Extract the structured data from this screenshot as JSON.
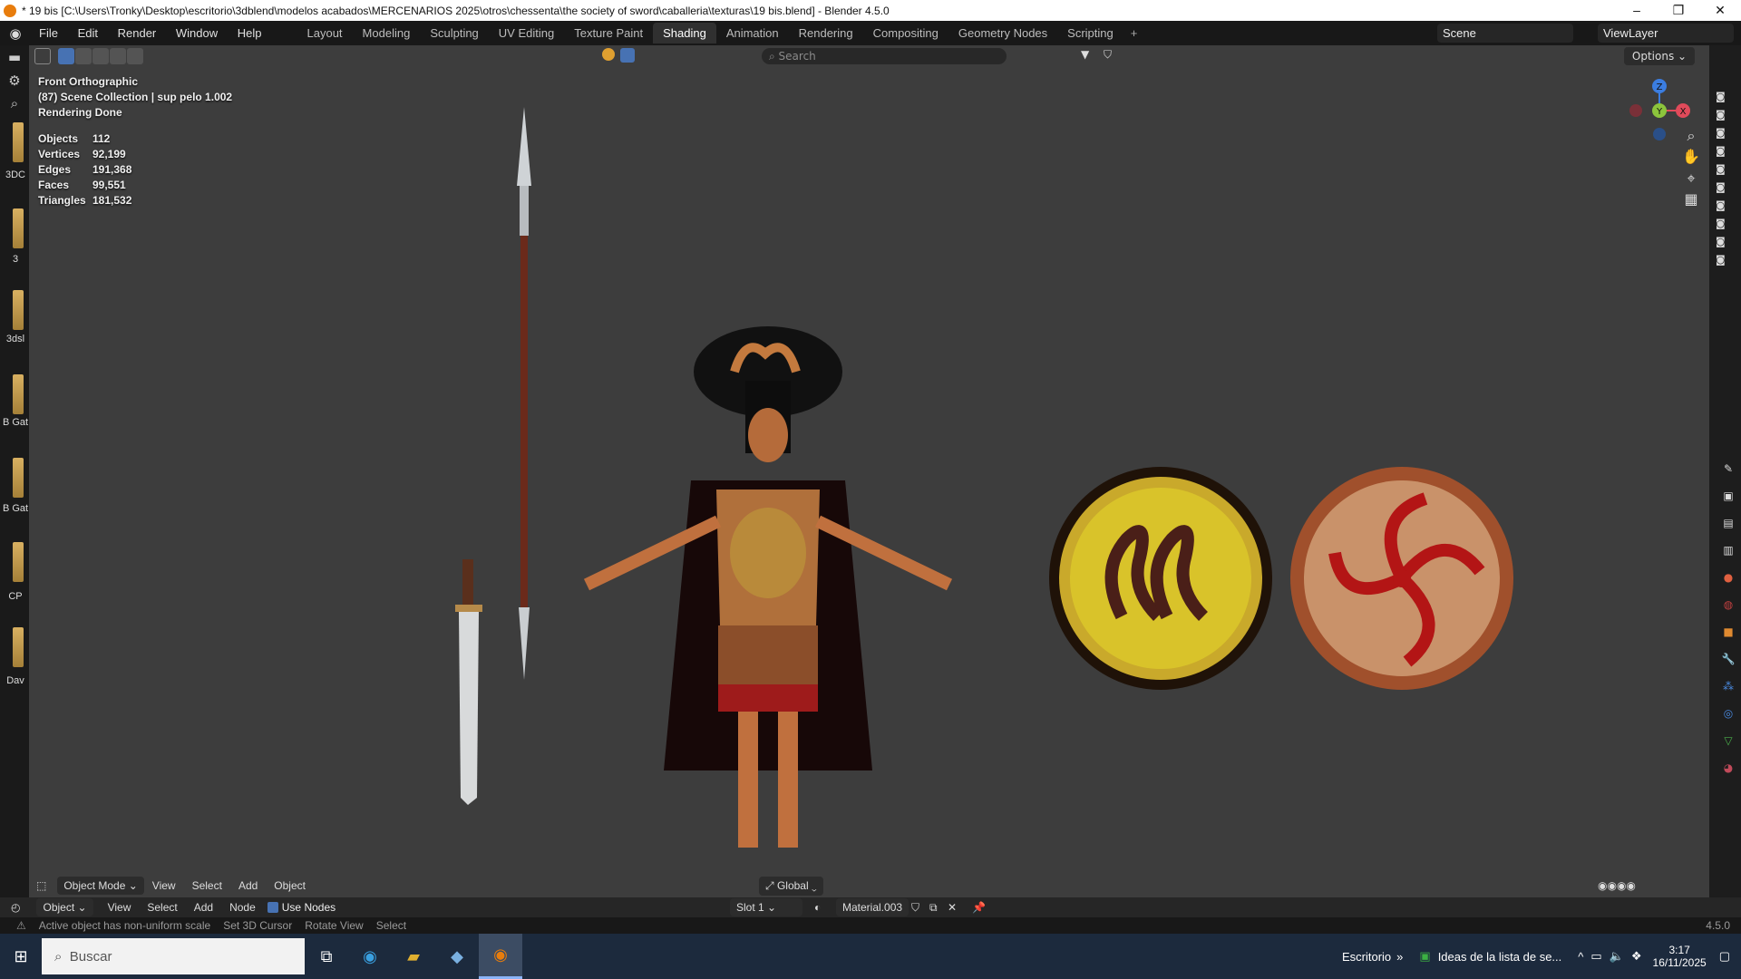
{
  "window": {
    "title": "* 19 bis [C:\\Users\\Tronky\\Desktop\\escritorio\\3dblend\\modelos acabados\\MERCENARIOS 2025\\otros\\chessenta\\the society of sword\\caballeria\\texturas\\19 bis.blend] - Blender 4.5.0",
    "controls": [
      "–",
      "❐",
      "✕"
    ]
  },
  "topbar": {
    "menus": [
      "File",
      "Edit",
      "Render",
      "Window",
      "Help"
    ],
    "workspaces": [
      "Layout",
      "Modeling",
      "Sculpting",
      "UV Editing",
      "Texture Paint",
      "Shading",
      "Animation",
      "Rendering",
      "Compositing",
      "Geometry Nodes",
      "Scripting"
    ],
    "active_workspace": "Shading",
    "add_workspace": "+",
    "scene": "Scene",
    "view_layer": "ViewLayer"
  },
  "viewport": {
    "search_placeholder": "Search",
    "options": "Options",
    "view_name": "Front Orthographic",
    "collection": "(87) Scene Collection | sup pelo 1.002",
    "render_status": "Rendering Done",
    "stats": [
      {
        "label": "Objects",
        "value": "112"
      },
      {
        "label": "Vertices",
        "value": "92,199"
      },
      {
        "label": "Edges",
        "value": "191,368"
      },
      {
        "label": "Faces",
        "value": "99,551"
      },
      {
        "label": "Triangles",
        "value": "181,532"
      }
    ],
    "gizmo": {
      "x": "X",
      "y": "Y",
      "z": "Z"
    },
    "bottom": {
      "mode": "Object Mode",
      "menus": [
        "View",
        "Select",
        "Add",
        "Object"
      ],
      "orientation": "Global"
    }
  },
  "asset_labels": [
    "3DC",
    "3",
    "3dsl",
    "B Gat",
    "B Gat",
    "CP",
    "Dav"
  ],
  "shader_editor": {
    "object_type": "Object",
    "menus": [
      "View",
      "Select",
      "Add",
      "Node"
    ],
    "use_nodes_label": "Use Nodes",
    "use_nodes": true,
    "slot": "Slot 1",
    "material": "Material.003"
  },
  "statusbar": {
    "warning": "Active object has non-uniform scale",
    "hints": [
      "Set 3D Cursor",
      "Rotate View",
      "Select"
    ],
    "version": "4.5.0"
  },
  "taskbar": {
    "search_placeholder": "Buscar",
    "desktop_label": "Escritorio",
    "notification": "Ideas de la lista de se...",
    "time": "3:17",
    "date": "16/11/2025"
  }
}
